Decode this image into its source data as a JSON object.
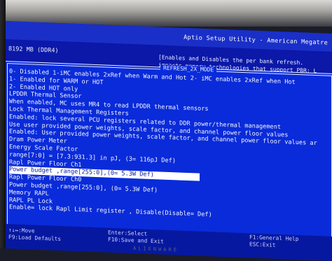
{
  "window": {
    "title": "Aptio Setup Utility - American Megatre"
  },
  "memory_line": "8192 MB (DDR4)",
  "help": {
    "lines": [
      "[Enables and Disables the per bank refresh.",
      "impacts memory technologies that support PBR: L"
    ]
  },
  "popup": {
    "title": "REFRESH_2X_MODE",
    "options": [
      "0- Disabled 1-iMC enables 2xRef when Warm and Hot 2- iMC enables 2xRef when Hot",
      "1- Enabled for WARM or HOT",
      "2- Enabled HOT only",
      "LPDDR Thermal Sensor",
      "When enabled, MC uses MR4 to read LPDDR thermal sensors",
      "Lock Thermal Management Registers",
      "Enabled: lock several PCU registers related to DDR power/thermal management",
      "Use user provided power weights, scale factor, and channel power floor values",
      "Enabled: User provided power weights, scale factor, and channel power floor values ar",
      "Dram Power Meter",
      "Energy Scale Factor",
      "range[7:0] = [7.3:931.3] in pJ, (3= 116pJ Def)",
      "Rapl Power Floor Ch1",
      "Power budget ,range[255:0],(0= 5.3W Def)",
      "Rapl Power Floor Ch0",
      "Power budget ,range[255:0], (0= 5.3W Def)",
      "Memory RAPL",
      "RAPL PL Lock",
      "Enable= lock Rapl Limit register , Disable(Disable= Def)"
    ],
    "selected_index": 13
  },
  "footer": {
    "col1": [
      "↑↓↔:Move",
      "F9:Load Defaults"
    ],
    "col2": [
      "Enter:Select",
      "F10:Save and Exit"
    ],
    "col3": [
      "F1:General Help",
      "ESC:Exit"
    ],
    "brand": "ALIENWARE"
  }
}
